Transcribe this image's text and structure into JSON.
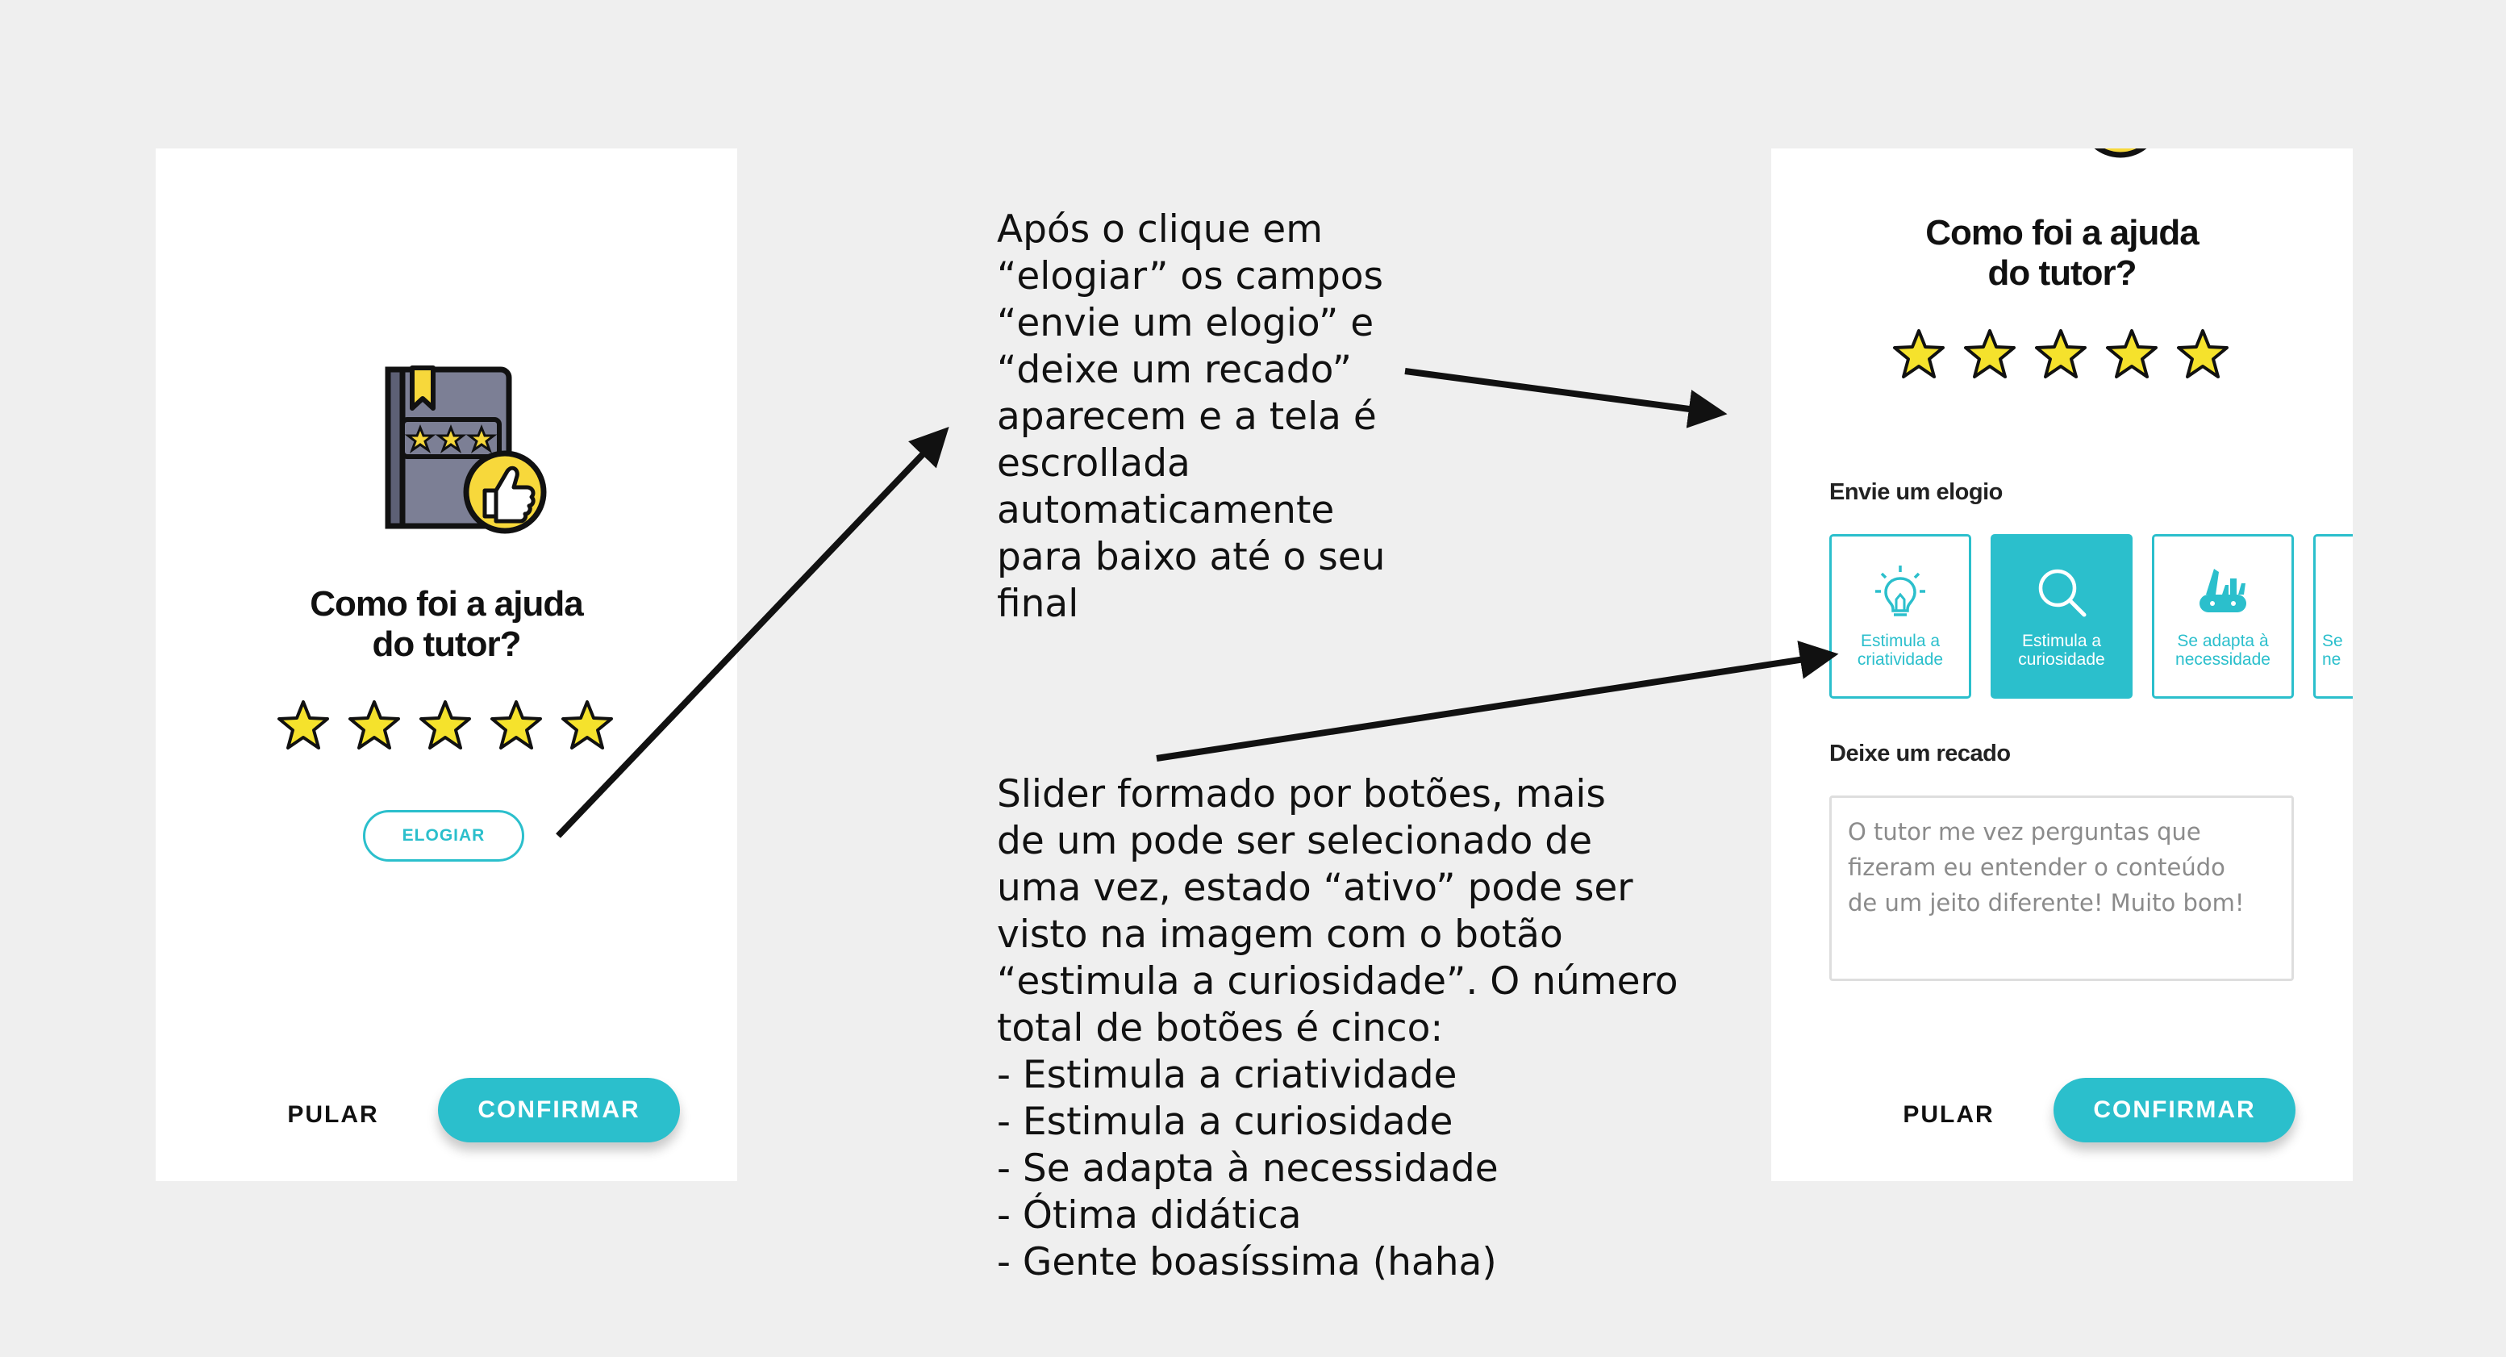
{
  "left_screen": {
    "question_line1": "Como foi a ajuda",
    "question_line2": "do tutor?",
    "rating": 5,
    "rating_max": 5,
    "elogiar_label": "ELOGIAR",
    "pular_label": "PULAR",
    "confirmar_label": "CONFIRMAR"
  },
  "right_screen": {
    "question_line1": "Como foi a ajuda",
    "question_line2": "do tutor?",
    "rating": 5,
    "rating_max": 5,
    "praise_label": "Envie um elogio",
    "chips": [
      {
        "line1": "Estimula a",
        "line2": "criatividade",
        "icon": "lightbulb-icon",
        "active": false
      },
      {
        "line1": "Estimula a",
        "line2": "curiosidade",
        "icon": "magnifier-icon",
        "active": true
      },
      {
        "line1": "Se adapta à",
        "line2": "necessidade",
        "icon": "swiss-knife-icon",
        "active": false
      },
      {
        "line1": "Se",
        "line2": "ne",
        "icon": "",
        "active": false
      }
    ],
    "message_label": "Deixe um recado",
    "message_value": [
      "O tutor me vez perguntas que",
      "fizeram eu entender o conteúdo",
      "de um jeito diferente! Muito bom!"
    ],
    "pular_label": "PULAR",
    "confirmar_label": "CONFIRMAR"
  },
  "annotation_top": [
    "Após o clique em",
    "“elogiar” os campos",
    "“envie um elogio” e",
    "“deixe um recado”",
    "aparecem e a tela é",
    "escrollada",
    "automaticamente",
    "para baixo até o seu",
    "final"
  ],
  "annotation_bottom": [
    "Slider formado por botões, mais",
    "de um pode ser selecionado de",
    "uma vez, estado “ativo” pode ser",
    "visto na imagem com o botão",
    "“estimula a curiosidade”. O número",
    "total de botões é cinco:",
    "- Estimula a criatividade",
    "- Estimula a curiosidade",
    "- Se adapta à necessidade",
    "- Ótima didática",
    "- Gente boasíssima (haha)"
  ],
  "colors": {
    "accent": "#2bbfcc",
    "star_fill": "#f5e22c",
    "book_cover": "#7c7f95",
    "badge": "#f7d83b",
    "background": "#efefef"
  }
}
